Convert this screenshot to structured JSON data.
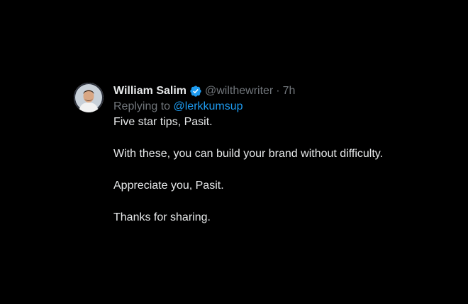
{
  "tweet": {
    "author": {
      "display_name": "William Salim",
      "handle": "@wilthewriter",
      "verified": true,
      "avatar_icon": "person-avatar"
    },
    "separator": "·",
    "timestamp": "7h",
    "reply": {
      "prefix": "Replying to",
      "mention": "@lerkkumsup"
    },
    "paragraphs": [
      "Five star tips, Pasit.",
      "With these, you can build your brand without difficulty.",
      "Appreciate you, Pasit.",
      "Thanks for sharing."
    ]
  },
  "colors": {
    "background": "#000000",
    "primary_text": "#e7e9ea",
    "secondary_text": "#71767b",
    "link": "#1d9bf0",
    "verified_badge": "#1d9bf0"
  }
}
